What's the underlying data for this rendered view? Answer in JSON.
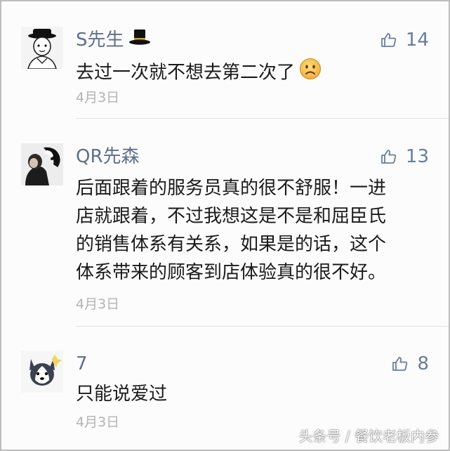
{
  "comments": [
    {
      "username": "S先生",
      "likes": "14",
      "lines": [
        "去过一次就不想去第二次了"
      ],
      "date": "4月3日",
      "username_emoji": "top-hat-icon",
      "text_emoji": "frowning-face-icon"
    },
    {
      "username": "QR先森",
      "likes": "13",
      "lines": [
        "后面跟着的服务员真的很不舒服！一进",
        "店就跟着，不过我想这是不是和屈臣氏",
        "的销售体系有关系，如果是的话，这个",
        "体系带来的顾客到店体验真的很不好。"
      ],
      "date": "4月3日"
    },
    {
      "username": "7",
      "likes": "8",
      "lines": [
        "只能说爱过"
      ],
      "date": "4月3日"
    }
  ],
  "watermark": "头条号 / 餐饮老板内参",
  "colors": {
    "username": "#5f6f8c",
    "like": "#6a7d9b",
    "body_text": "#1a1a1a",
    "date": "#b3b3b3"
  }
}
